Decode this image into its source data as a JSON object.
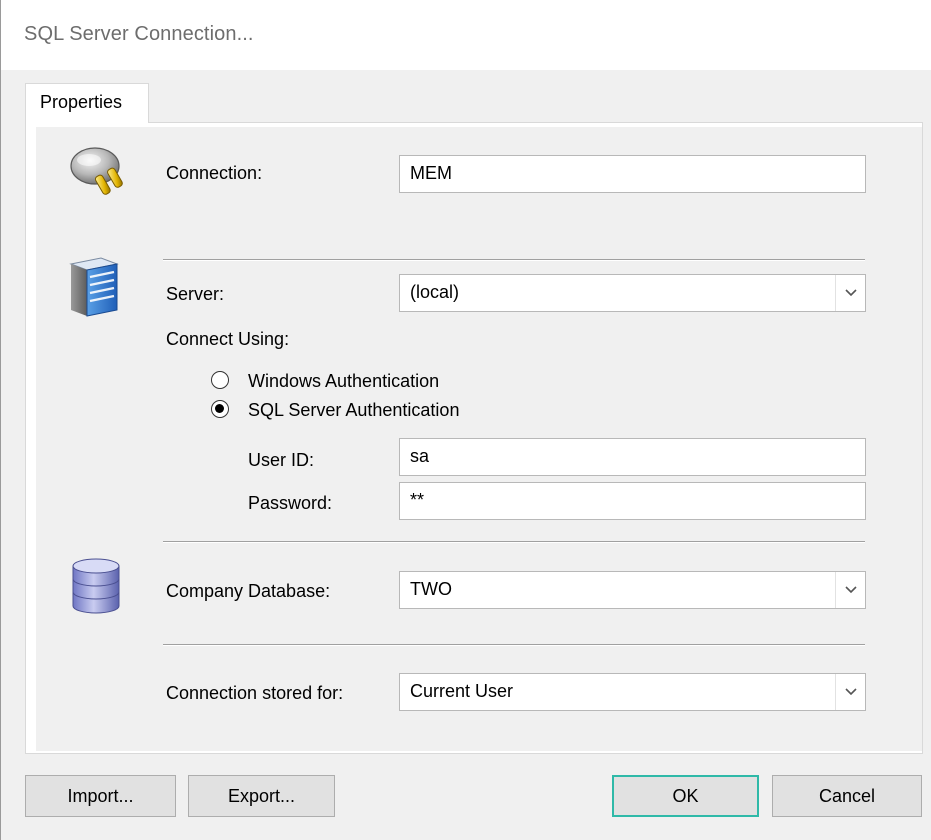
{
  "window": {
    "title": "SQL Server Connection..."
  },
  "tabs": [
    {
      "label": "Properties",
      "active": true
    }
  ],
  "connection": {
    "label": "Connection:",
    "value": "MEM",
    "icon": "plug-icon"
  },
  "server": {
    "label": "Server:",
    "value": "(local)",
    "icon": "server-icon"
  },
  "connect_using": {
    "label": "Connect Using:",
    "options": [
      {
        "label": "Windows Authentication",
        "selected": false
      },
      {
        "label": "SQL Server Authentication",
        "selected": true
      }
    ]
  },
  "credentials": {
    "user_id_label": "User ID:",
    "user_id_value": "sa",
    "password_label": "Password:",
    "password_value": "**"
  },
  "company_database": {
    "label": "Company Database:",
    "value": "TWO",
    "icon": "database-icon"
  },
  "stored_for": {
    "label": "Connection stored for:",
    "value": "Current User"
  },
  "buttons": {
    "import": "Import...",
    "export": "Export...",
    "ok": "OK",
    "cancel": "Cancel"
  },
  "colors": {
    "accent": "#2fb9a8",
    "background": "#f0f0f0",
    "title_text": "#6d6d6d"
  }
}
